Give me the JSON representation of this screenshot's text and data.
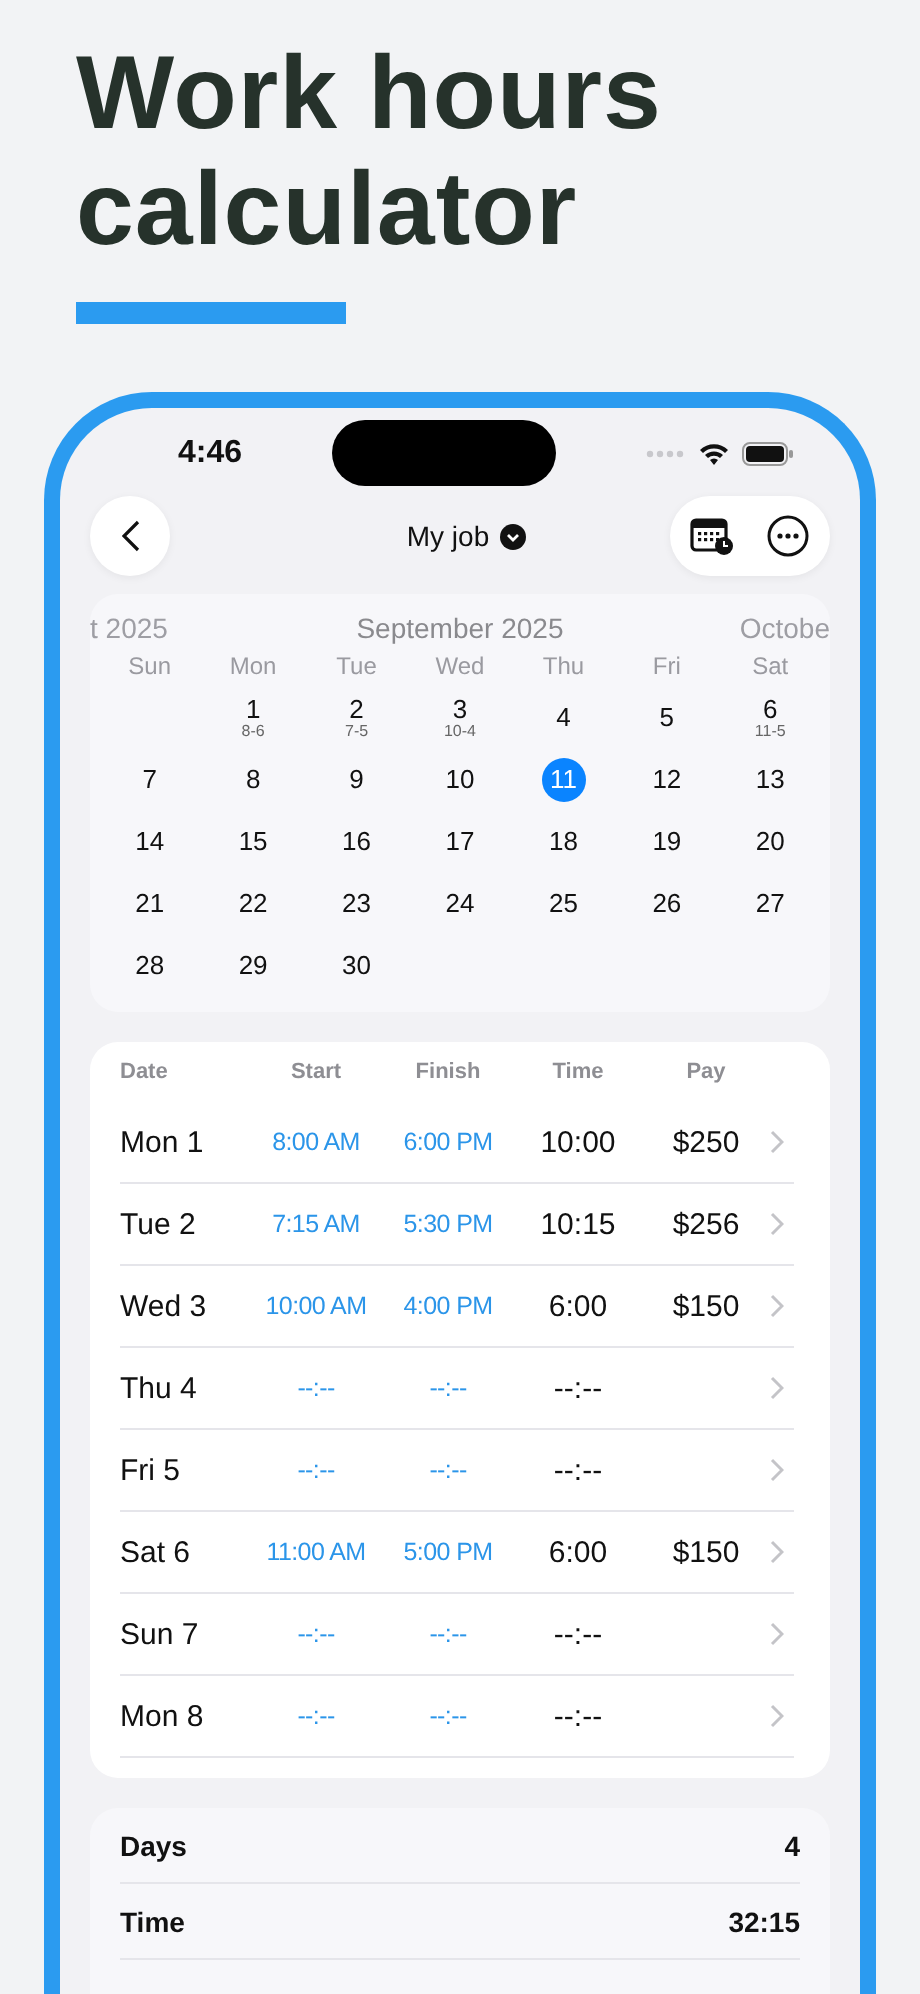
{
  "headline": "Work hours calculator",
  "status_bar": {
    "time": "4:46"
  },
  "nav": {
    "title": "My job"
  },
  "calendar": {
    "prev_month": "t 2025",
    "month": "September 2025",
    "next_month": "Octobe",
    "weekdays": [
      "Sun",
      "Mon",
      "Tue",
      "Wed",
      "Thu",
      "Fri",
      "Sat"
    ],
    "weeks": [
      [
        {
          "kind": "blank"
        },
        {
          "day": "1",
          "hours": "8-6",
          "selected": false
        },
        {
          "day": "2",
          "hours": "7-5",
          "selected": false
        },
        {
          "day": "3",
          "hours": "10-4",
          "selected": false
        },
        {
          "day": "4",
          "selected": false
        },
        {
          "day": "5",
          "selected": false
        },
        {
          "day": "6",
          "hours": "11-5",
          "selected": false
        }
      ],
      [
        {
          "day": "7",
          "selected": false
        },
        {
          "day": "8",
          "selected": false
        },
        {
          "day": "9",
          "selected": false
        },
        {
          "day": "10",
          "selected": false
        },
        {
          "day": "11",
          "selected": true
        },
        {
          "day": "12",
          "selected": false
        },
        {
          "day": "13",
          "selected": false
        }
      ],
      [
        {
          "day": "14",
          "selected": false
        },
        {
          "day": "15",
          "selected": false
        },
        {
          "day": "16",
          "selected": false
        },
        {
          "day": "17",
          "selected": false
        },
        {
          "day": "18",
          "selected": false
        },
        {
          "day": "19",
          "selected": false
        },
        {
          "day": "20",
          "selected": false
        }
      ],
      [
        {
          "day": "21",
          "selected": false
        },
        {
          "day": "22",
          "selected": false
        },
        {
          "day": "23",
          "selected": false
        },
        {
          "day": "24",
          "selected": false
        },
        {
          "day": "25",
          "selected": false
        },
        {
          "day": "26",
          "selected": false
        },
        {
          "day": "27",
          "selected": false
        }
      ],
      [
        {
          "day": "28",
          "selected": false
        },
        {
          "day": "29",
          "selected": false
        },
        {
          "day": "30",
          "selected": false
        }
      ]
    ]
  },
  "table": {
    "columns": [
      "Date",
      "Start",
      "Finish",
      "Time",
      "Pay"
    ],
    "rows": [
      {
        "date": "Mon 1",
        "start": "8:00 AM",
        "finish": "6:00 PM",
        "time": "10:00",
        "pay": "$250"
      },
      {
        "date": "Tue 2",
        "start": "7:15 AM",
        "finish": "5:30 PM",
        "time": "10:15",
        "pay": "$256"
      },
      {
        "date": "Wed 3",
        "start": "10:00 AM",
        "finish": "4:00 PM",
        "time": "6:00",
        "pay": "$150"
      },
      {
        "date": "Thu 4",
        "start": "--:--",
        "finish": "--:--",
        "time": "--:--"
      },
      {
        "date": "Fri 5",
        "start": "--:--",
        "finish": "--:--",
        "time": "--:--"
      },
      {
        "date": "Sat 6",
        "start": "11:00 AM",
        "finish": "5:00 PM",
        "time": "6:00",
        "pay": "$150"
      },
      {
        "date": "Sun 7",
        "start": "--:--",
        "finish": "--:--",
        "time": "--:--"
      },
      {
        "date": "Mon 8",
        "start": "--:--",
        "finish": "--:--",
        "time": "--:--"
      }
    ]
  },
  "summary": [
    {
      "label": "Days",
      "value": "4"
    },
    {
      "label": "Time",
      "value": "32:15"
    }
  ]
}
